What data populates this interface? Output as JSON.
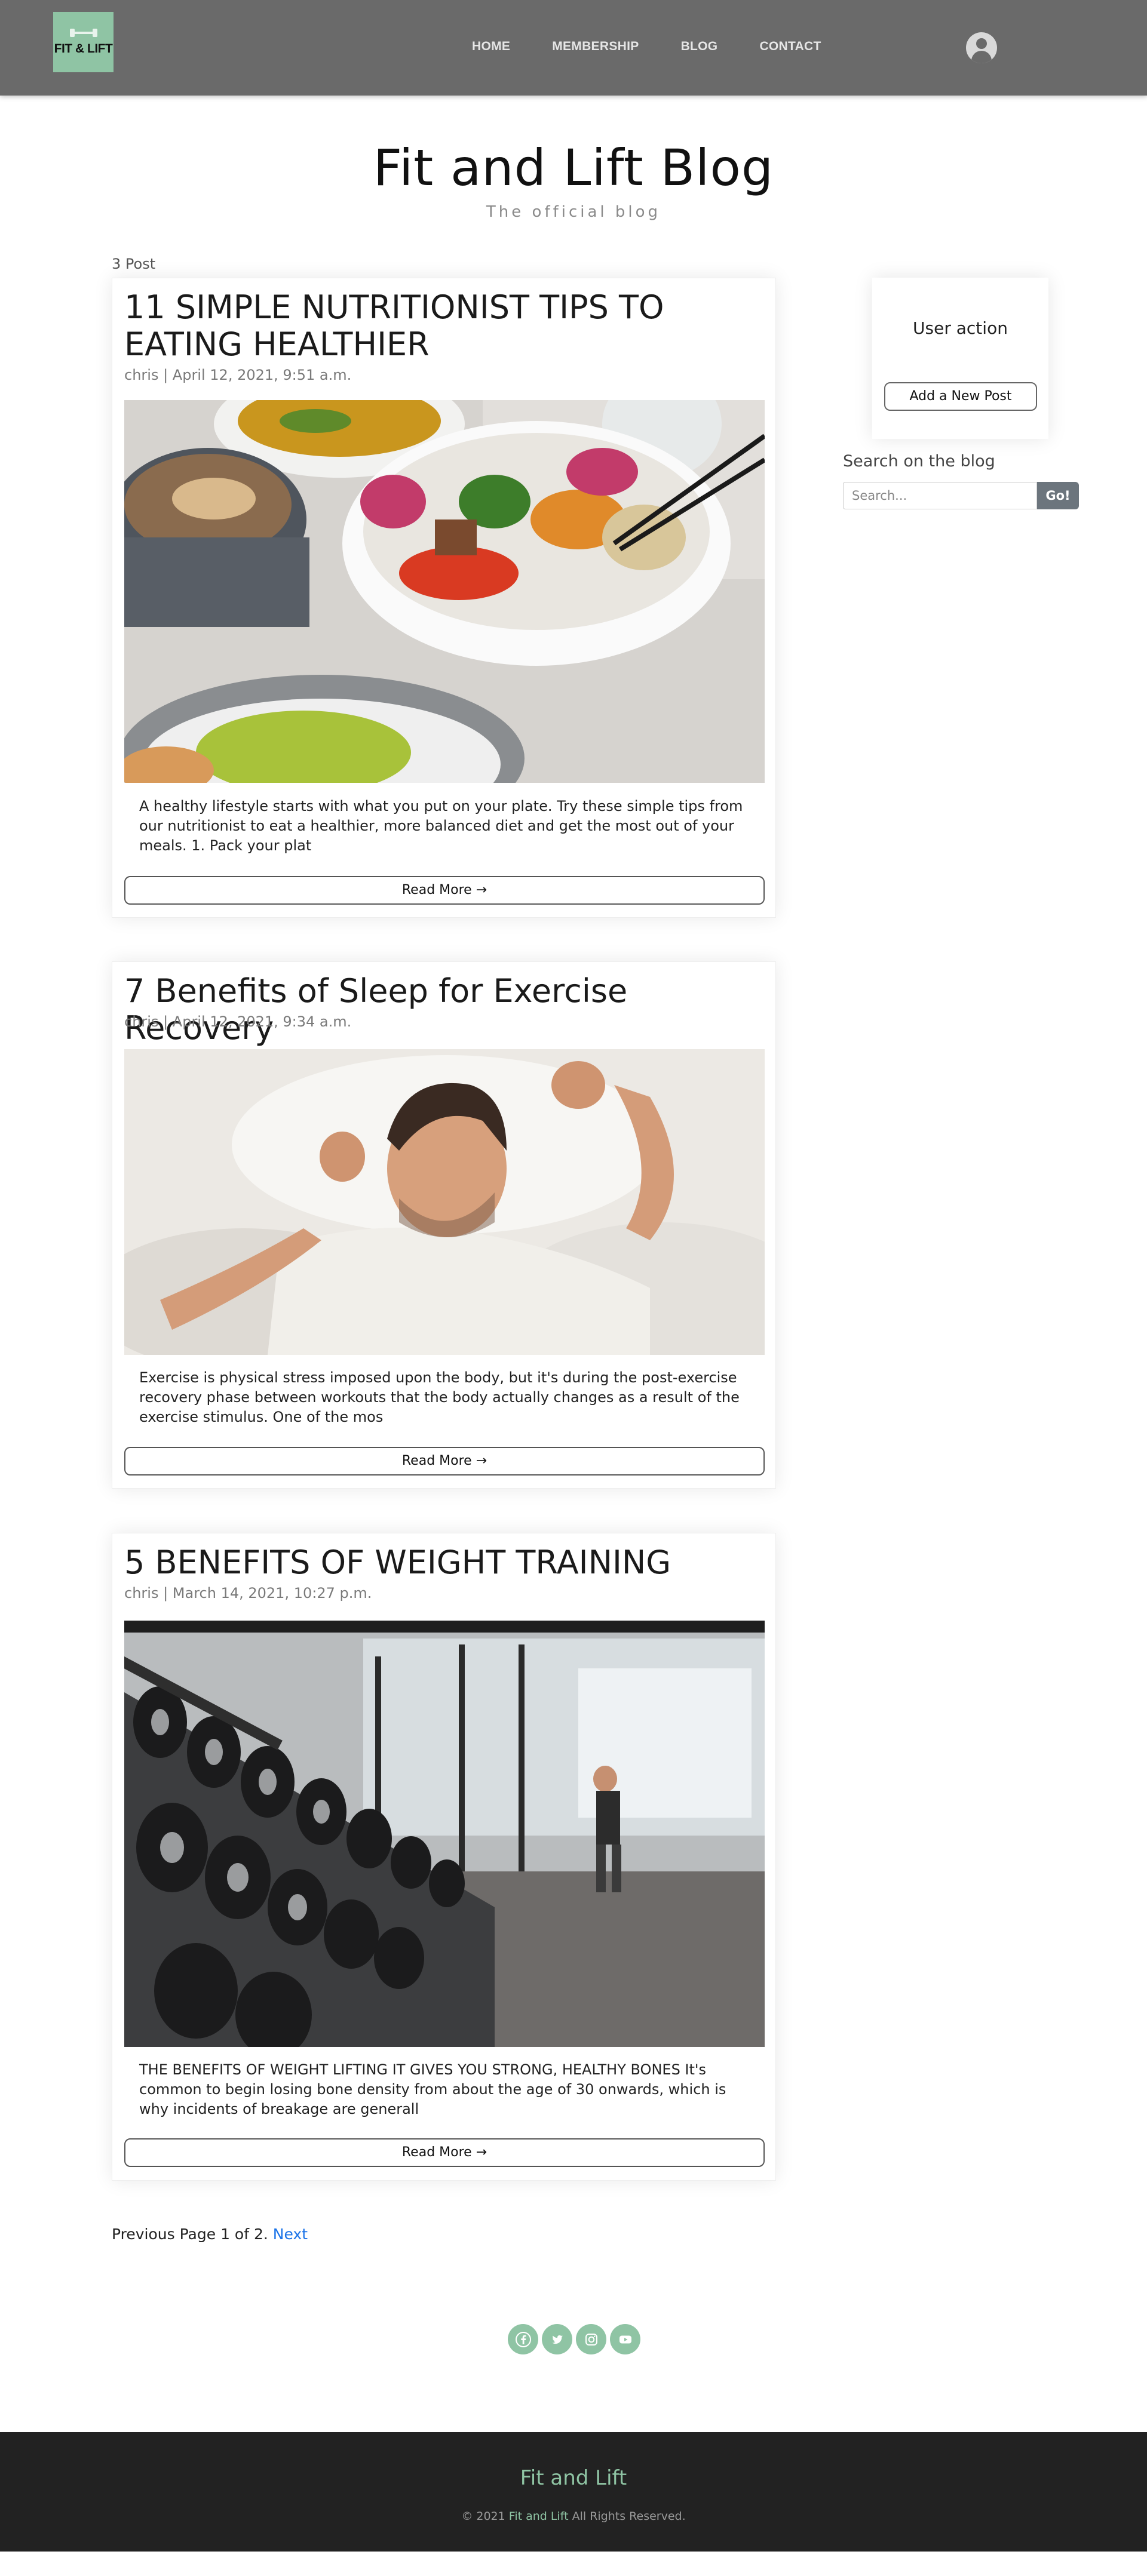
{
  "nav": {
    "logo_text": "FIT & LIFT",
    "links": [
      "HOME",
      "MEMBERSHIP",
      "BLOG",
      "CONTACT"
    ]
  },
  "header": {
    "title": "Fit and Lift Blog",
    "subtitle": "The official blog"
  },
  "post_count": "3 Post",
  "posts": [
    {
      "title": "11 SIMPLE NUTRITIONIST TIPS TO EATING HEALTHIER",
      "meta": "chris | April 12, 2021, 9:51 a.m.",
      "excerpt": "A healthy lifestyle starts with what you put on your plate. Try these simple tips from our nutritionist to eat a healthier, more balanced diet and get the most out of your meals. 1. Pack your plat",
      "read_more": "Read More →"
    },
    {
      "title": "7 Benefits of Sleep for Exercise Recovery",
      "meta": "chris | April 12, 2021, 9:34 a.m.",
      "excerpt": "Exercise is physical stress imposed upon the body, but it's during the post-exercise recovery phase between workouts that the body actually changes as a result of the exercise stimulus. One of the mos",
      "read_more": "Read More →"
    },
    {
      "title": "5 BENEFITS OF WEIGHT TRAINING",
      "meta": "chris | March 14, 2021, 10:27 p.m.",
      "excerpt": "THE BENEFITS OF WEIGHT LIFTING IT GIVES YOU STRONG, HEALTHY BONES It's common to begin losing bone density from about the age of 30 onwards, which is why incidents of breakage are generall",
      "read_more": "Read More →"
    }
  ],
  "sidebar": {
    "user_action_title": "User action",
    "add_post_label": "Add a New Post",
    "search_label": "Search on the blog",
    "search_placeholder": "Search...",
    "search_button": "Go!"
  },
  "pagination": {
    "text": "Previous Page 1 of 2.",
    "next": "Next"
  },
  "social_icons": [
    "facebook-icon",
    "twitter-icon",
    "instagram-icon",
    "youtube-icon"
  ],
  "footer": {
    "brand": "Fit and Lift",
    "copy_prefix": "© 2021",
    "copy_brand": "Fit and Lift",
    "copy_suffix": "All Rights Reserved."
  },
  "colors": {
    "navbar": "#6a6a6a",
    "accent_green": "#8fc4a4",
    "footer": "#222222",
    "link_blue": "#1a73e8"
  }
}
